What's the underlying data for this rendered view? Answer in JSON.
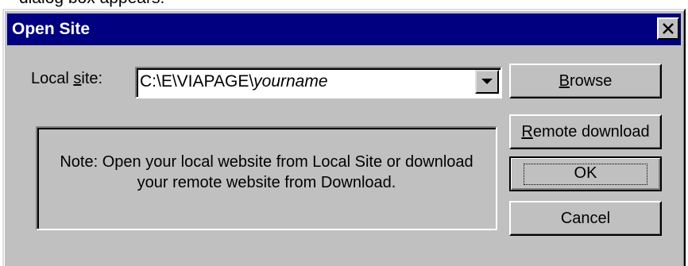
{
  "page_caption": "dialog box appears.",
  "dialog": {
    "title": "Open Site",
    "close_label": "×"
  },
  "local_site": {
    "label_prefix": "Local ",
    "label_underlined": "s",
    "label_suffix": "ite:",
    "value_path": "C:\\E\\VIAPAGE\\",
    "value_name": "yourname"
  },
  "note": {
    "line1": "Note: Open your local website from Local Site or download",
    "line2": "your remote website from Download."
  },
  "buttons": {
    "browse": {
      "underlined": "B",
      "rest": "rowse"
    },
    "remote_download": {
      "underlined": "R",
      "rest": "emote download"
    },
    "ok": "OK",
    "cancel": "Cancel"
  }
}
